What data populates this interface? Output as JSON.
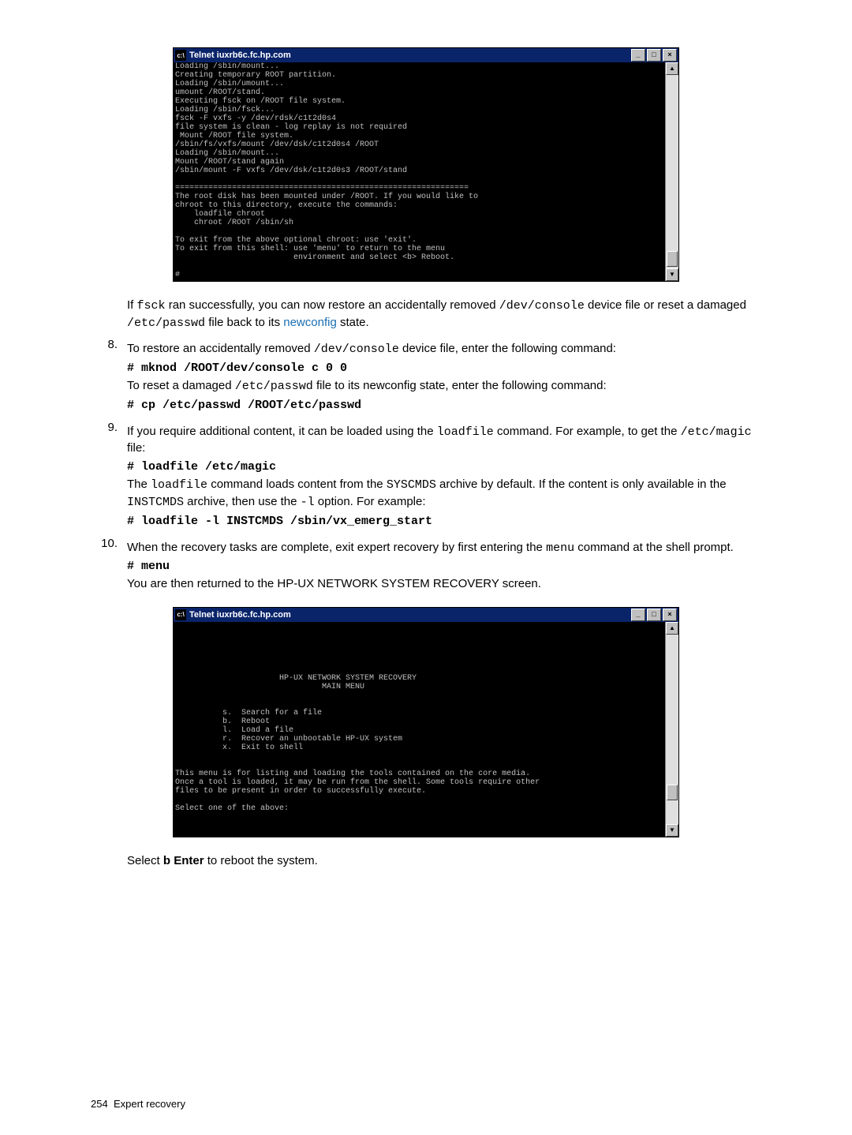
{
  "terminal1": {
    "title": "Telnet iuxrb6c.fc.hp.com",
    "content": "Loading /sbin/mount...\nCreating temporary ROOT partition.\nLoading /sbin/umount...\numount /ROOT/stand.\nExecuting fsck on /ROOT file system.\nLoading /sbin/fsck...\nfsck -F vxfs -y /dev/rdsk/c1t2d0s4\nfile system is clean - log replay is not required\n Mount /ROOT file system.\n/sbin/fs/vxfs/mount /dev/dsk/c1t2d0s4 /ROOT\nLoading /sbin/mount...\nMount /ROOT/stand again\n/sbin/mount -F vxfs /dev/dsk/c1t2d0s3 /ROOT/stand\n\n==============================================================\nThe root disk has been mounted under /ROOT. If you would like to\nchroot to this directory, execute the commands:\n    loadfile chroot\n    chroot /ROOT /sbin/sh\n\nTo exit from the above optional chroot: use 'exit'.\nTo exit from this shell: use 'menu' to return to the menu\n                         environment and select <b> Reboot.\n\n#"
  },
  "para1_pre": "If ",
  "para1_code1": "fsck",
  "para1_mid1": " ran successfully, you can now restore an accidentally removed ",
  "para1_code2": "/dev/console",
  "para1_mid2": " device file or reset a damaged ",
  "para1_code3": "/etc/passwd",
  "para1_mid3": " file back to its ",
  "para1_link": "newconfig",
  "para1_end": " state.",
  "step8": {
    "num": "8.",
    "l1_a": "To restore an accidentally removed ",
    "l1_code": "/dev/console",
    "l1_b": " device file, enter the following command:",
    "cmd1": "# mknod /ROOT/dev/console c 0 0",
    "l2_a": "To reset a damaged ",
    "l2_code": "/etc/passwd",
    "l2_b": " file to its newconfig state, enter the following command:",
    "cmd2": "# cp /etc/passwd /ROOT/etc/passwd"
  },
  "step9": {
    "num": "9.",
    "l1_a": "If you require additional content, it can be loaded using the ",
    "l1_code1": "loadfile",
    "l1_b": " command. For example, to get the ",
    "l1_code2": "/etc/magic",
    "l1_c": " file:",
    "cmd1": "# loadfile /etc/magic",
    "l2_a": "The ",
    "l2_code1": "loadfile",
    "l2_b": " command loads content from the ",
    "l2_code2": "SYSCMDS",
    "l2_c": " archive by default. If the content is only available in the ",
    "l2_code3": "INSTCMDS",
    "l2_d": " archive, then use the ",
    "l2_code4": "-l",
    "l2_e": " option. For example:",
    "cmd2": "# loadfile -l INSTCMDS /sbin/vx_emerg_start"
  },
  "step10": {
    "num": "10.",
    "l1_a": "When the recovery tasks are complete, exit expert recovery by first entering the ",
    "l1_code": "menu",
    "l1_b": " command at the shell prompt.",
    "cmd1": "# menu",
    "l2": "You are then returned to the HP-UX NETWORK SYSTEM RECOVERY screen."
  },
  "terminal2": {
    "title": "Telnet iuxrb6c.fc.hp.com",
    "content": "\n\n\n\n\n\n                      HP-UX NETWORK SYSTEM RECOVERY\n                               MAIN MENU\n\n\n          s.  Search for a file\n          b.  Reboot\n          l.  Load a file\n          r.  Recover an unbootable HP-UX system\n          x.  Exit to shell\n\n\nThis menu is for listing and loading the tools contained on the core media.\nOnce a tool is loaded, it may be run from the shell. Some tools require other\nfiles to be present in order to successfully execute.\n\nSelect one of the above:"
  },
  "final_a": "Select ",
  "final_b": "b Enter",
  "final_c": " to reboot the system.",
  "footer_num": "254",
  "footer_txt": "Expert recovery"
}
